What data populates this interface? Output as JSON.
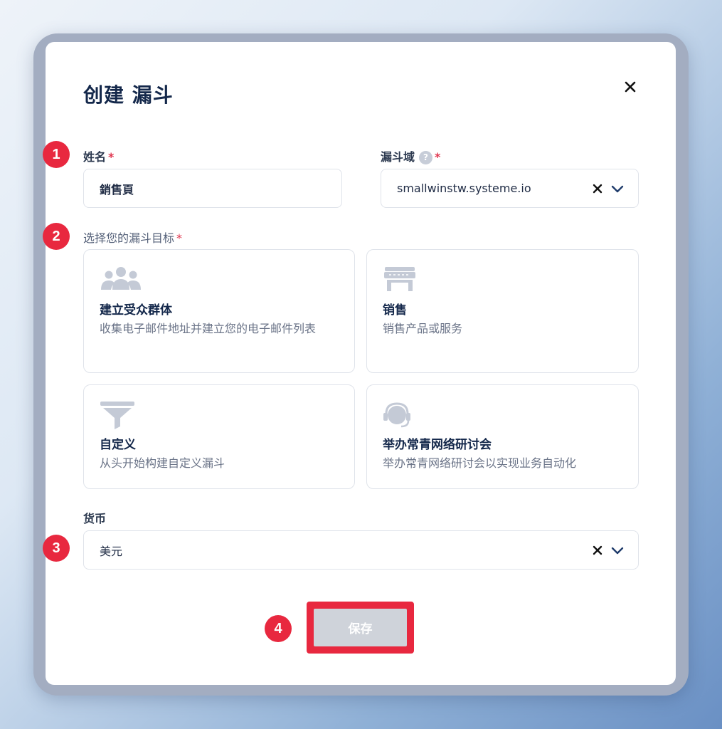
{
  "modal": {
    "title": "创建 漏斗",
    "close_icon": "×"
  },
  "name_field": {
    "label": "姓名",
    "required_mark": "*",
    "value": "銷售頁"
  },
  "domain_field": {
    "label": "漏斗域",
    "help_icon": "?",
    "required_mark": "*",
    "value": "smallwinstw.systeme.io"
  },
  "goal_section": {
    "label": "选择您的漏斗目标",
    "required_mark": "*",
    "options": [
      {
        "icon": "audience-icon",
        "title": "建立受众群体",
        "description": "收集电子邮件地址并建立您的电子邮件列表"
      },
      {
        "icon": "store-icon",
        "title": "销售",
        "description": "销售产品或服务"
      },
      {
        "icon": "funnel-icon",
        "title": "自定义",
        "description": "从头开始构建自定义漏斗"
      },
      {
        "icon": "headset-icon",
        "title": "举办常青网络研讨会",
        "description": "举办常青网络研讨会以实现业务自动化"
      }
    ]
  },
  "currency_field": {
    "label": "货币",
    "value": "美元"
  },
  "save_button": {
    "label": "保存"
  },
  "step_badges": [
    "1",
    "2",
    "3",
    "4"
  ],
  "colors": {
    "accent_red": "#e8283f",
    "title_navy": "#14284b",
    "disabled_button": "#cfd3da"
  }
}
